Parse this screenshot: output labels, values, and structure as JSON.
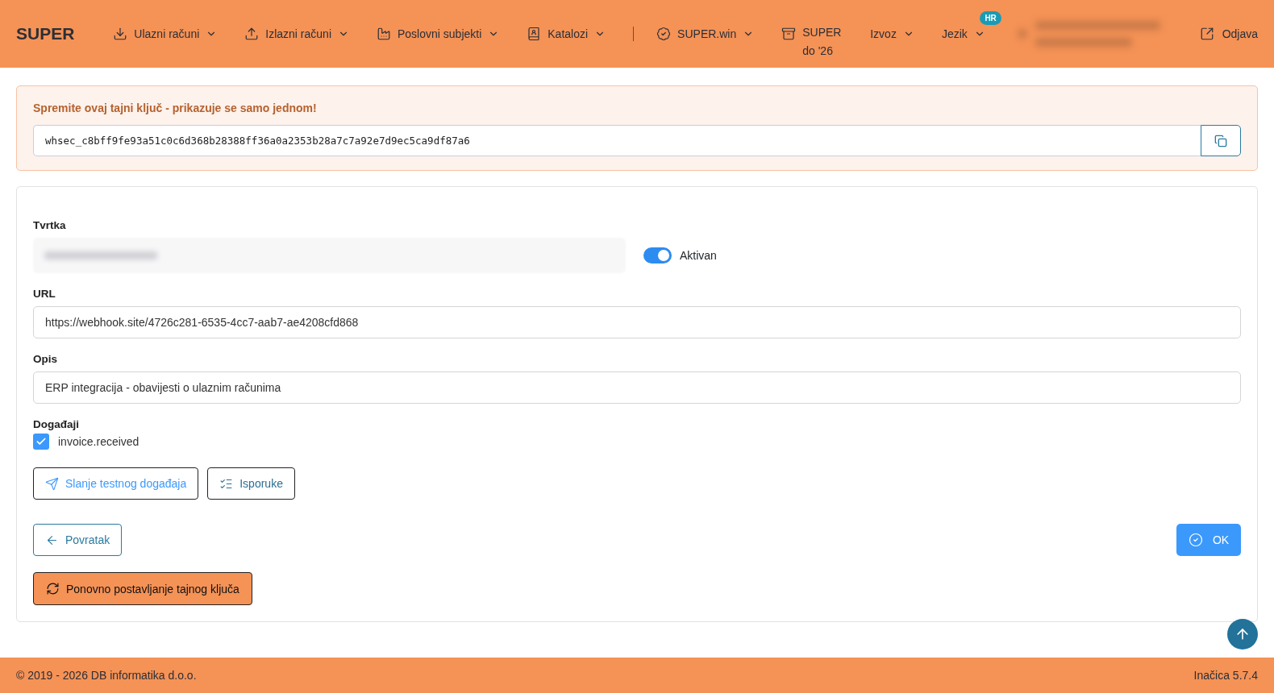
{
  "header": {
    "brand": "SUPER",
    "nav": [
      {
        "label": "Ulazni računi",
        "dropdown": true
      },
      {
        "label": "Izlazni računi",
        "dropdown": true
      },
      {
        "label": "Poslovni subjekti",
        "dropdown": true
      },
      {
        "label": "Katalozi",
        "dropdown": true
      }
    ],
    "nav_right": [
      {
        "label": "SUPER.win",
        "dropdown": true
      },
      {
        "label": "SUPER do '26",
        "dropdown": false
      },
      {
        "label": "Izvoz",
        "dropdown": true
      },
      {
        "label": "Jezik",
        "dropdown": true,
        "badge": "HR"
      }
    ],
    "logout": "Odjava"
  },
  "secret_alert": {
    "message": "Spremite ovaj tajni ključ - prikazuje se samo jednom!",
    "secret": "whsec_c8bff9fe93a51c0c6d368b28388ff36a0a2353b28a7c7a92e7d9ec5ca9df87a6"
  },
  "form": {
    "company_label": "Tvrtka",
    "active": {
      "label": "Aktivan",
      "on": true
    },
    "url_label": "URL",
    "url": "https://webhook.site/4726c281-6535-4cc7-aab7-ae4208cfd868",
    "description_label": "Opis",
    "description": "ERP integracija - obavijesti o ulaznim računima",
    "events_label": "Događaji",
    "events": [
      {
        "label": "invoice.received",
        "checked": true
      }
    ],
    "test_button": "Slanje testnog događaja",
    "deliveries_button": "Isporuke",
    "back_button": "Povratak",
    "ok_button": "OK",
    "reset_button": "Ponovno postavljanje tajnog ključa"
  },
  "footer": {
    "copyright": "© 2019 - 2026 DB informatika d.o.o.",
    "version": "Inačica 5.7.4"
  }
}
